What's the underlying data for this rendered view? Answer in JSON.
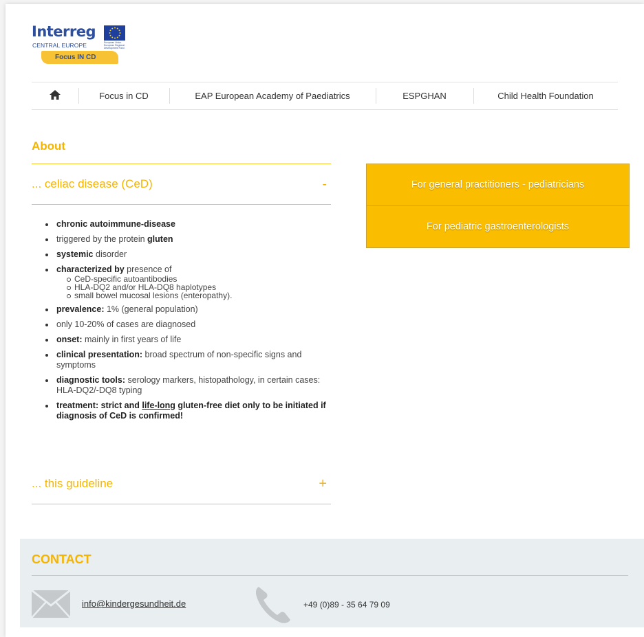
{
  "logo": {
    "word": "Interreg",
    "sub": "CENTRAL EUROPE",
    "fine": "European Union European Regional Development Fund",
    "badge": "Focus IN CD"
  },
  "nav": {
    "items": [
      {
        "label": "Focus in CD"
      },
      {
        "label": "EAP European Academy of Paediatrics"
      },
      {
        "label": "ESPGHAN"
      },
      {
        "label": "Child Health Foundation"
      }
    ]
  },
  "about": {
    "title": "About",
    "section1": {
      "title": "... celiac disease (CeD)",
      "toggle": "-",
      "bullets": {
        "b1_bold": "chronic autoimmune-disease",
        "b2_text": "triggered by the protein ",
        "b2_bold": "gluten",
        "b3_bold": "systemic",
        "b3_text": " disorder",
        "b4_bold": "characterized by",
        "b4_text": " presence of",
        "b4_sub": [
          "CeD-specific autoantibodies",
          "HLA-DQ2 and/or HLA-DQ8 haplotypes",
          "small bowel mucosal lesions (enteropathy)."
        ],
        "b5_bold": "prevalence:",
        "b5_text": " 1% (general population)",
        "b6_text": "only 10-20% of cases are diagnosed",
        "b7_bold": "onset:",
        "b7_text": " mainly in first years of life",
        "b8_bold": "clinical presentation:",
        "b8_text": " broad spectrum of non-specific signs and symptoms",
        "b9_bold": "diagnostic tools:",
        "b9_text": " serology markers, histopathology, in certain cases: HLA-DQ2/-DQ8 typing",
        "b10_a": "treatment: strict and ",
        "b10_u": "life-long",
        "b10_b": " gluten-free diet only to be initiated if diagnosis of CeD is confirmed!"
      }
    },
    "section2": {
      "title": "... this guideline",
      "toggle": "+"
    }
  },
  "cta": {
    "gp": "For general practitioners - pediatricians",
    "gastro": "For pediatric gastroenterologists"
  },
  "contact": {
    "title": "CONTACT",
    "email": "info@kindergesundheit.de",
    "phone": "+49 (0)89 - 35 64 79 09"
  },
  "colors": {
    "accent": "#f5b400",
    "cta_bg": "#fbbd00",
    "brand_blue": "#2e4f9e",
    "contact_bg": "#e9eef1"
  },
  "icons": [
    "home-icon",
    "eu-flag-icon",
    "mail-icon",
    "phone-icon"
  ]
}
